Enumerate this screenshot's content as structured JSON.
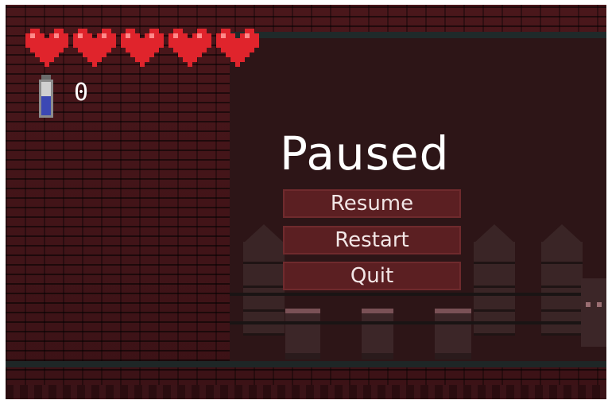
{
  "hud": {
    "hearts": {
      "count": 5,
      "icon": "heart-icon",
      "color": "#e0242c"
    },
    "potion": {
      "icon": "potion-icon",
      "color": "#3c48b4",
      "count": "0"
    }
  },
  "pause_menu": {
    "title": "Paused",
    "buttons": {
      "resume": "Resume",
      "restart": "Restart",
      "quit": "Quit"
    }
  }
}
